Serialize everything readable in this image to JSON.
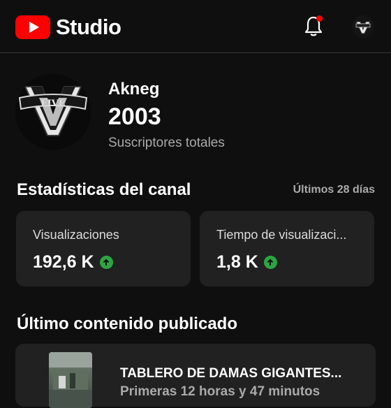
{
  "header": {
    "logo_text": "Studio",
    "icons": {
      "bell": "bell-icon",
      "avatar": "channel-avatar"
    },
    "notification_dot_color": "#ff0000",
    "brand_color": "#ff0000"
  },
  "channel": {
    "name": "Akneg",
    "subscribers": "2003",
    "subscribers_label": "Suscriptores totales"
  },
  "stats": {
    "title": "Estadísticas del canal",
    "range": "Últimos 28 días",
    "cards": [
      {
        "label": "Visualizaciones",
        "value": "192,6 K",
        "trend": "up"
      },
      {
        "label": "Tiempo de visualizaci...",
        "value": "1,8 K",
        "trend": "up"
      }
    ],
    "trend_color": "#2ba640"
  },
  "latest": {
    "title": "Último contenido publicado",
    "video_title": "TABLERO DE DAMAS GIGANTES...",
    "video_subtitle": "Primeras 12 horas y 47 minutos"
  }
}
